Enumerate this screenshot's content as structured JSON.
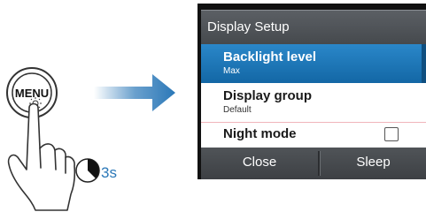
{
  "illustration": {
    "menu_key_label": "MENU",
    "hold_duration": "3s",
    "accent_color": "#2b78b8"
  },
  "dialog": {
    "title": "Display Setup",
    "items": [
      {
        "label": "Backlight level",
        "value": "Max",
        "selected": true
      },
      {
        "label": "Display group",
        "value": "Default",
        "selected": false
      },
      {
        "label": "Night mode",
        "value": "",
        "selected": false,
        "control": "checkbox"
      }
    ],
    "buttons": {
      "close": "Close",
      "sleep": "Sleep"
    },
    "selection_color": "#1f78bb"
  }
}
